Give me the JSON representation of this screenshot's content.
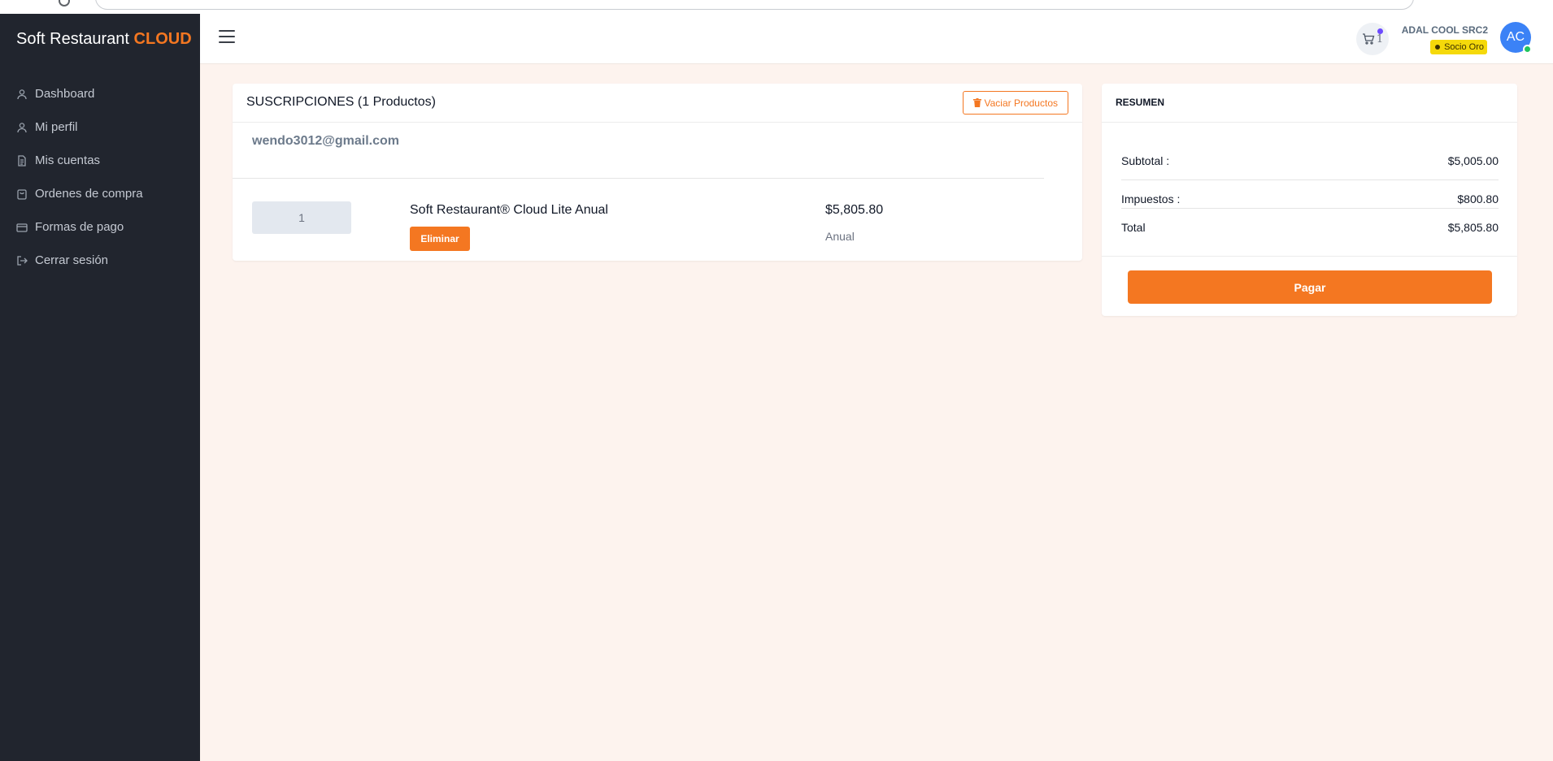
{
  "brand": {
    "name": "Soft Restaurant ",
    "accent": "CLOUD"
  },
  "sidebar": {
    "items": [
      {
        "label": "Dashboard",
        "icon": "user-icon"
      },
      {
        "label": "Mi perfil",
        "icon": "user-icon"
      },
      {
        "label": "Mis cuentas",
        "icon": "document-icon"
      },
      {
        "label": "Ordenes de compra",
        "icon": "shopping-bag-icon"
      },
      {
        "label": "Formas de pago",
        "icon": "credit-card-icon"
      },
      {
        "label": "Cerrar sesión",
        "icon": "logout-icon"
      }
    ]
  },
  "topbar": {
    "cart_count": "1",
    "user_name": "ADAL COOL SRC2",
    "badge": "Socio Oro",
    "avatar_initials": "AC"
  },
  "cart": {
    "title": "SUSCRIPCIONES (1 Productos)",
    "empty_button": "Vaciar Productos",
    "email": "wendo3012@gmail.com",
    "items": [
      {
        "quantity": "1",
        "name": "Soft Restaurant® Cloud Lite Anual",
        "remove_label": "Eliminar",
        "price": "$5,805.80",
        "period": "Anual"
      }
    ]
  },
  "summary": {
    "title": "RESUMEN",
    "subtotal_label": "Subtotal :",
    "subtotal_value": "$5,005.00",
    "taxes_label": "Impuestos :",
    "taxes_value": "$800.80",
    "total_label": "Total",
    "total_value": "$5,805.80",
    "pay_button": "Pagar"
  },
  "colors": {
    "accent": "#f47721",
    "sidebar_bg": "#21252e",
    "page_bg": "#fdf3ee",
    "badge_gold": "#f5d90a",
    "avatar_bg": "#3b82f6"
  }
}
